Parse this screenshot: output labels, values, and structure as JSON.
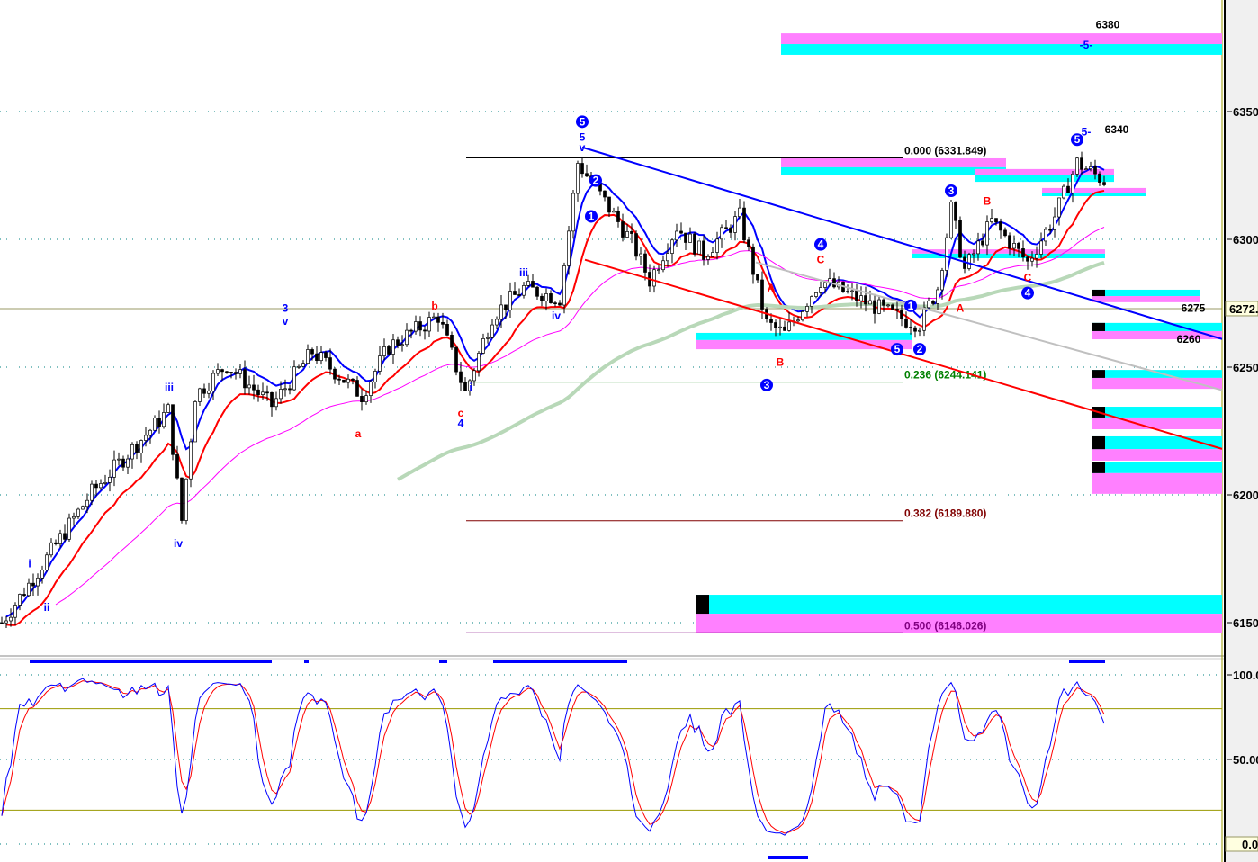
{
  "chart_data": {
    "type": "candlestick",
    "title": "",
    "price_axis": {
      "ylim": [
        6140,
        6393
      ],
      "ticks": [
        6350,
        6300,
        6250,
        6200,
        6150
      ],
      "tick_labels": [
        "6350",
        "6300",
        "6250",
        "6200",
        "6150"
      ],
      "current_price_label": "6272.",
      "current_price": 6272.9
    },
    "stoch_axis": {
      "ylim": [
        -6,
        108
      ],
      "ticks": [
        100,
        50,
        0
      ],
      "tick_labels": [
        "100.0",
        "50.00",
        "0.0"
      ],
      "levels": [
        80,
        20
      ]
    },
    "price_path": [
      {
        "bar": 0,
        "close": 6150
      },
      {
        "bar": 6,
        "close": 6165
      },
      {
        "bar": 20,
        "close": 6201
      },
      {
        "bar": 37,
        "close": 6233
      },
      {
        "bar": 40,
        "close": 6190
      },
      {
        "bar": 43,
        "close": 6239
      },
      {
        "bar": 50,
        "close": 6251
      },
      {
        "bar": 60,
        "close": 6235
      },
      {
        "bar": 69,
        "close": 6256
      },
      {
        "bar": 80,
        "close": 6239
      },
      {
        "bar": 86,
        "close": 6258
      },
      {
        "bar": 97,
        "close": 6270
      },
      {
        "bar": 103,
        "close": 6240
      },
      {
        "bar": 109,
        "close": 6270
      },
      {
        "bar": 116,
        "close": 6281
      },
      {
        "bar": 124,
        "close": 6277
      },
      {
        "bar": 128,
        "close": 6330
      },
      {
        "bar": 132,
        "close": 6320
      },
      {
        "bar": 140,
        "close": 6299
      },
      {
        "bar": 144,
        "close": 6284
      },
      {
        "bar": 150,
        "close": 6305
      },
      {
        "bar": 156,
        "close": 6294
      },
      {
        "bar": 164,
        "close": 6309
      },
      {
        "bar": 170,
        "close": 6267
      },
      {
        "bar": 174,
        "close": 6263
      },
      {
        "bar": 182,
        "close": 6284
      },
      {
        "bar": 190,
        "close": 6277
      },
      {
        "bar": 200,
        "close": 6269
      },
      {
        "bar": 204,
        "close": 6267
      },
      {
        "bar": 208,
        "close": 6281
      },
      {
        "bar": 211,
        "close": 6312
      },
      {
        "bar": 214,
        "close": 6288
      },
      {
        "bar": 220,
        "close": 6307
      },
      {
        "bar": 228,
        "close": 6291
      },
      {
        "bar": 234,
        "close": 6309
      },
      {
        "bar": 239,
        "close": 6330
      },
      {
        "bar": 245,
        "close": 6323
      }
    ],
    "fib_levels": [
      {
        "label": "0.000 (6331.849)",
        "price": 6331.849,
        "color": "#000000"
      },
      {
        "label": "0.236 (6244.141)",
        "price": 6244.141,
        "color": "#008000"
      },
      {
        "label": "0.382 (6189.880)",
        "price": 6189.88,
        "color": "#800000"
      },
      {
        "label": "0.500 (6146.026)",
        "price": 6146.026,
        "color": "#800080"
      }
    ],
    "trendlines": [
      {
        "name": "blue-trendline",
        "color": "#0000ff",
        "from": {
          "bar": 129.4,
          "price": 6336
        },
        "to": {
          "bar": 271.6,
          "price": 6261
        }
      },
      {
        "name": "red-trendline",
        "color": "#ff0000",
        "from": {
          "bar": 130,
          "price": 6292
        },
        "to": {
          "bar": 271.6,
          "price": 6218
        }
      },
      {
        "name": "gray-trendline",
        "color": "#c0c0c0",
        "from": {
          "bar": 168,
          "price": 6291
        },
        "to": {
          "bar": 271.6,
          "price": 6241
        }
      }
    ],
    "zones": [
      {
        "from": 173.6,
        "to": 271.6,
        "top": 6380.6,
        "mid": 6376.4,
        "bottom": 6372.2,
        "order": "magenta-cyan",
        "block": false
      },
      {
        "from": 173.6,
        "to": 223.6,
        "top": 6331.7,
        "mid": 6328.2,
        "bottom": 6325.0,
        "order": "magenta-cyan",
        "block": false
      },
      {
        "from": 216.6,
        "to": 247.6,
        "top": 6327.5,
        "mid": 6325.0,
        "bottom": 6322.5,
        "order": "magenta-cyan",
        "block": false
      },
      {
        "from": 231.6,
        "to": 254.6,
        "top": 6320.1,
        "mid": 6318.3,
        "bottom": 6316.9,
        "order": "magenta-cyan",
        "block": false
      },
      {
        "from": 202.6,
        "to": 245.6,
        "top": 6296.1,
        "mid": 6294.4,
        "bottom": 6292.6,
        "order": "magenta-cyan",
        "block": false
      },
      {
        "from": 154.6,
        "to": 202.6,
        "top": 6263.4,
        "mid": 6260.6,
        "bottom": 6257.0,
        "order": "cyan-magenta",
        "block": false
      },
      {
        "from": 242.6,
        "to": 266.6,
        "top": 6280.3,
        "mid": 6277.8,
        "bottom": 6275.4,
        "order": "cyan-magenta",
        "block": true
      },
      {
        "from": 242.6,
        "to": 271.6,
        "top": 6267.3,
        "mid": 6264.1,
        "bottom": 6260.9,
        "order": "cyan-magenta",
        "block": true
      },
      {
        "from": 242.6,
        "to": 271.6,
        "top": 6248.9,
        "mid": 6245.8,
        "bottom": 6241.5,
        "order": "cyan-magenta",
        "block": true
      },
      {
        "from": 242.6,
        "to": 271.6,
        "top": 6234.5,
        "mid": 6230.3,
        "bottom": 6225.7,
        "order": "cyan-magenta",
        "block": true
      },
      {
        "from": 242.6,
        "to": 271.6,
        "top": 6222.9,
        "mid": 6217.9,
        "bottom": 6213.4,
        "order": "cyan-magenta",
        "block": true
      },
      {
        "from": 242.6,
        "to": 271.6,
        "top": 6213.0,
        "mid": 6208.5,
        "bottom": 6200.4,
        "order": "cyan-magenta",
        "block": true
      },
      {
        "from": 154.6,
        "to": 271.6,
        "top": 6160.9,
        "mid": 6153.5,
        "bottom": 6145.8,
        "order": "cyan-magenta",
        "block": true
      }
    ],
    "annotations": [
      {
        "text": "5",
        "bar": 129.4,
        "price": 6346,
        "color": "#0000ff",
        "circled": true
      },
      {
        "text": "5",
        "bar": 129.4,
        "price": 6340,
        "color": "#0000ff",
        "circled": false
      },
      {
        "text": "v",
        "bar": 129.4,
        "price": 6336,
        "color": "#0000ff",
        "circled": false
      },
      {
        "text": "2",
        "bar": 132.4,
        "price": 6323,
        "color": "#0000ff",
        "circled": true
      },
      {
        "text": "1",
        "bar": 131.4,
        "price": 6309,
        "color": "#0000ff",
        "circled": true
      },
      {
        "text": "iii",
        "bar": 116.4,
        "price": 6287,
        "color": "#0000ff",
        "circled": false
      },
      {
        "text": "iv",
        "bar": 123.6,
        "price": 6270,
        "color": "#0000ff",
        "circled": false
      },
      {
        "text": "3",
        "bar": 63.4,
        "price": 6273,
        "color": "#0000ff",
        "circled": false
      },
      {
        "text": "v",
        "bar": 63.4,
        "price": 6268,
        "color": "#0000ff",
        "circled": false
      },
      {
        "text": "b",
        "bar": 96.6,
        "price": 6274,
        "color": "#ff0000",
        "circled": false
      },
      {
        "text": "a",
        "bar": 79.6,
        "price": 6224,
        "color": "#ff0000",
        "circled": false
      },
      {
        "text": "c",
        "bar": 102.4,
        "price": 6232,
        "color": "#ff0000",
        "circled": false
      },
      {
        "text": "4",
        "bar": 102.4,
        "price": 6228,
        "color": "#0000ff",
        "circled": false
      },
      {
        "text": "i",
        "bar": 104.6,
        "price": 6242,
        "color": "#0000ff",
        "circled": false
      },
      {
        "text": "iii",
        "bar": 37.6,
        "price": 6242,
        "color": "#0000ff",
        "circled": false
      },
      {
        "text": "iv",
        "bar": 39.6,
        "price": 6181,
        "color": "#0000ff",
        "circled": false
      },
      {
        "text": "i",
        "bar": 6.6,
        "price": 6173,
        "color": "#0000ff",
        "circled": false
      },
      {
        "text": "ii",
        "bar": 10.4,
        "price": 6156,
        "color": "#0000ff",
        "circled": false
      },
      {
        "text": "4",
        "bar": 182.4,
        "price": 6298,
        "color": "#0000ff",
        "circled": true
      },
      {
        "text": "C",
        "bar": 182.4,
        "price": 6292,
        "color": "#ff0000",
        "circled": false
      },
      {
        "text": "A",
        "bar": 171.4,
        "price": 6281,
        "color": "#ff0000",
        "circled": false
      },
      {
        "text": "B",
        "bar": 173.4,
        "price": 6252,
        "color": "#ff0000",
        "circled": false
      },
      {
        "text": "3",
        "bar": 170.4,
        "price": 6243,
        "color": "#0000ff",
        "circled": true
      },
      {
        "text": "5",
        "bar": 199.4,
        "price": 6257,
        "color": "#0000ff",
        "circled": true
      },
      {
        "text": "2",
        "bar": 204.4,
        "price": 6257,
        "color": "#0000ff",
        "circled": true
      },
      {
        "text": "1",
        "bar": 202.4,
        "price": 6274,
        "color": "#0000ff",
        "circled": true
      },
      {
        "text": "3",
        "bar": 211.4,
        "price": 6319,
        "color": "#0000ff",
        "circled": true
      },
      {
        "text": "B",
        "bar": 219.4,
        "price": 6315,
        "color": "#ff0000",
        "circled": false
      },
      {
        "text": "A",
        "bar": 213.4,
        "price": 6273,
        "color": "#ff0000",
        "circled": false
      },
      {
        "text": "C",
        "bar": 228.4,
        "price": 6285,
        "color": "#ff0000",
        "circled": false
      },
      {
        "text": "4",
        "bar": 228.4,
        "price": 6279,
        "color": "#0000ff",
        "circled": true
      },
      {
        "text": "5",
        "bar": 239.4,
        "price": 6339,
        "color": "#0000ff",
        "circled": true
      },
      {
        "text": "5-",
        "bar": 241.4,
        "price": 6342,
        "color": "#0000ff",
        "circled": false
      },
      {
        "text": "-5-",
        "bar": 241.4,
        "price": 6376,
        "color": "#0000ff",
        "circled": false
      },
      {
        "text": "6340",
        "bar": 248.2,
        "price": 6343,
        "color": "#000000",
        "circled": false
      },
      {
        "text": "6380",
        "bar": 246.2,
        "price": 6384,
        "color": "#000000",
        "circled": false
      },
      {
        "text": "6275",
        "bar": 265.2,
        "price": 6273,
        "color": "#000000",
        "circled": false
      },
      {
        "text": "6260",
        "bar": 264.2,
        "price": 6261,
        "color": "#000000",
        "circled": false
      }
    ],
    "signal_segments": [
      {
        "from": 6.6,
        "to": 60.4
      },
      {
        "from": 67.6,
        "to": 68.6
      },
      {
        "from": 97.6,
        "to": 99.4
      },
      {
        "from": 109.6,
        "to": 139.4
      },
      {
        "from": 237.6,
        "to": 245.6
      }
    ],
    "series_colors": {
      "fast_ma": "#0000ff",
      "slow_ma": "#ff0000",
      "ma50": "#ff00ff",
      "ma200": "#b8d8b8",
      "stoch_k": "#0000ff",
      "stoch_d": "#ff0000"
    }
  }
}
